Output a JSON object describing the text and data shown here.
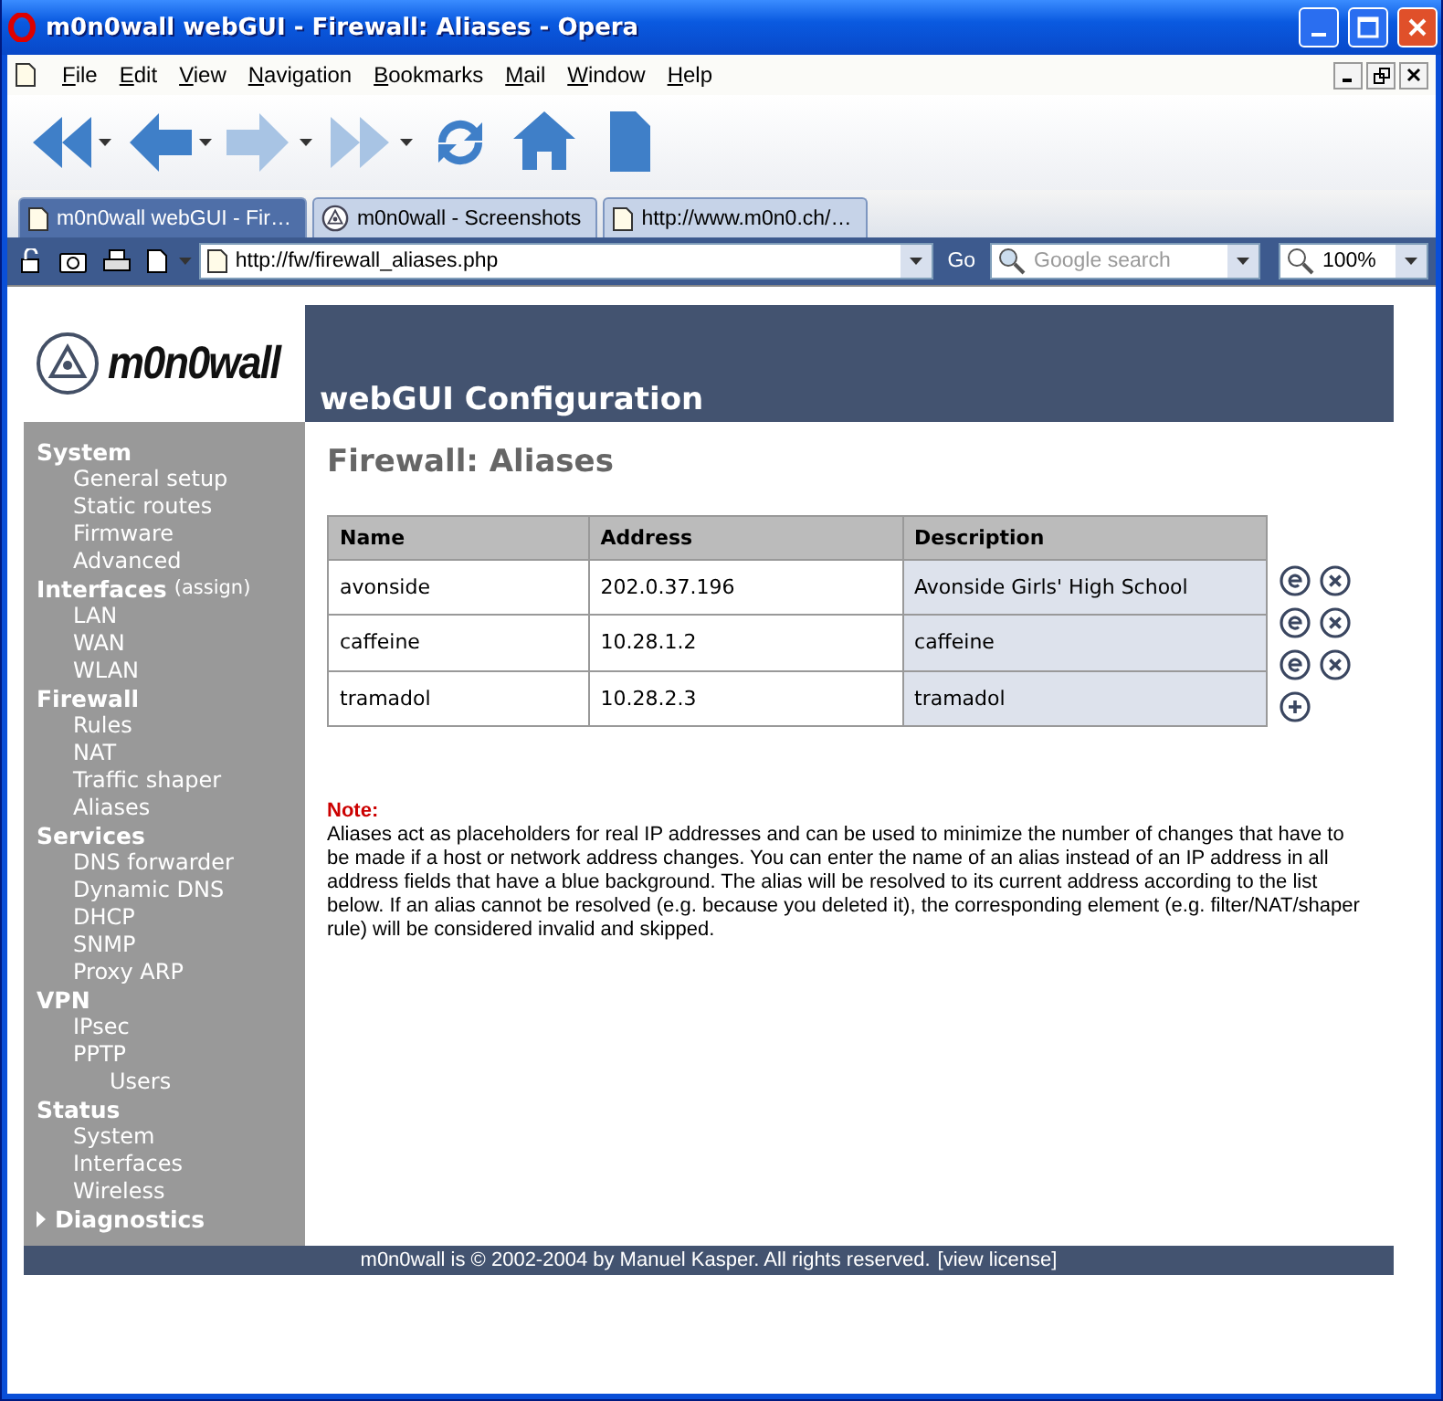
{
  "window": {
    "title": "m0n0wall webGUI - Firewall: Aliases - Opera"
  },
  "menu": [
    "File",
    "Edit",
    "View",
    "Navigation",
    "Bookmarks",
    "Mail",
    "Window",
    "Help"
  ],
  "tabs": [
    {
      "label": "m0n0wall webGUI - Fir…",
      "selected": true,
      "kind": "page"
    },
    {
      "label": "m0n0wall - Screenshots",
      "selected": false,
      "kind": "logo"
    },
    {
      "label": "http://www.m0n0.ch/…",
      "selected": false,
      "kind": "page"
    }
  ],
  "address_bar": {
    "url": "http://fw/firewall_aliases.php",
    "go": "Go",
    "search_placeholder": "Google search",
    "zoom": "100%"
  },
  "page": {
    "logo": "m0n0wall",
    "banner": "webGUI Configuration",
    "title": "Firewall: Aliases",
    "sidebar": [
      {
        "label": "System",
        "kind": "section",
        "children": [
          {
            "label": "General setup"
          },
          {
            "label": "Static routes"
          },
          {
            "label": "Firmware"
          },
          {
            "label": "Advanced"
          }
        ]
      },
      {
        "label": "Interfaces",
        "extra": "(assign)",
        "kind": "section",
        "children": [
          {
            "label": "LAN"
          },
          {
            "label": "WAN"
          },
          {
            "label": "WLAN"
          }
        ]
      },
      {
        "label": "Firewall",
        "kind": "section",
        "children": [
          {
            "label": "Rules"
          },
          {
            "label": "NAT"
          },
          {
            "label": "Traffic shaper"
          },
          {
            "label": "Aliases"
          }
        ]
      },
      {
        "label": "Services",
        "kind": "section",
        "children": [
          {
            "label": "DNS forwarder"
          },
          {
            "label": "Dynamic DNS"
          },
          {
            "label": "DHCP"
          },
          {
            "label": "SNMP"
          },
          {
            "label": "Proxy ARP"
          }
        ]
      },
      {
        "label": "VPN",
        "kind": "section",
        "children": [
          {
            "label": "IPsec"
          },
          {
            "label": "PPTP",
            "children": [
              {
                "label": "Users"
              }
            ]
          }
        ]
      },
      {
        "label": "Status",
        "kind": "section",
        "children": [
          {
            "label": "System"
          },
          {
            "label": "Interfaces"
          },
          {
            "label": "Wireless"
          }
        ]
      },
      {
        "label": "Diagnostics",
        "kind": "toggle",
        "expanded": false
      }
    ],
    "table": {
      "columns": [
        "Name",
        "Address",
        "Description"
      ],
      "rows": [
        [
          "avonside",
          "202.0.37.196",
          "Avonside Girls' High School"
        ],
        [
          "caffeine",
          "10.28.1.2",
          "caffeine"
        ],
        [
          "tramadol",
          "10.28.2.3",
          "tramadol"
        ]
      ]
    },
    "note": {
      "label": "Note:",
      "text": "Aliases act as placeholders for real IP addresses and can be used to minimize the number of changes that have to be made if a host or network address changes. You can enter the name of an alias instead of an IP address in all address fields that have a blue background. The alias will be resolved to its current address according to the list below. If an alias cannot be resolved (e.g. because you deleted it), the corresponding element (e.g. filter/NAT/shaper rule) will be considered invalid and skipped."
    },
    "footer": {
      "text": "m0n0wall is © 2002-2004 by Manuel Kasper. All rights reserved.",
      "link": "[view license]"
    }
  }
}
